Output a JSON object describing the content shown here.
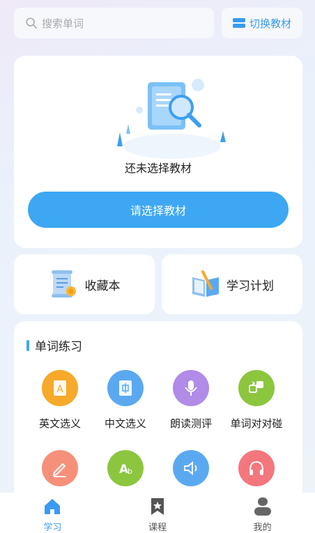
{
  "search": {
    "placeholder": "搜索单词"
  },
  "switch_button": {
    "label": "切换教材"
  },
  "textbook_card": {
    "empty_text": "还未选择教材",
    "choose_label": "请选择教材"
  },
  "quick_actions": [
    {
      "label": "收藏本",
      "icon": "certificate-scroll-icon"
    },
    {
      "label": "学习计划",
      "icon": "open-book-pencil-icon"
    }
  ],
  "practice": {
    "title": "单词练习",
    "items": [
      {
        "label": "英文选义",
        "icon": "english-card-icon",
        "color": "#f6a92a"
      },
      {
        "label": "中文选义",
        "icon": "chinese-card-icon",
        "color": "#5aa9f0"
      },
      {
        "label": "朗读测评",
        "icon": "microphone-icon",
        "color": "#b08be8"
      },
      {
        "label": "单词对对碰",
        "icon": "match-blocks-icon",
        "color": "#8cc63f"
      },
      {
        "label": "",
        "icon": "pencil-icon",
        "color": "#f6907a"
      },
      {
        "label": "",
        "icon": "ab-letters-icon",
        "color": "#8cc63f"
      },
      {
        "label": "",
        "icon": "speaker-icon",
        "color": "#5aa9f0"
      },
      {
        "label": "",
        "icon": "headphones-icon",
        "color": "#f4777d"
      }
    ]
  },
  "tabs": [
    {
      "label": "学习",
      "icon": "home-icon",
      "active": true
    },
    {
      "label": "课程",
      "icon": "bookmark-star-icon",
      "active": false
    },
    {
      "label": "我的",
      "icon": "person-icon",
      "active": false
    }
  ],
  "colors": {
    "accent": "#3da7f3",
    "accent_text": "#3a9bf0"
  }
}
